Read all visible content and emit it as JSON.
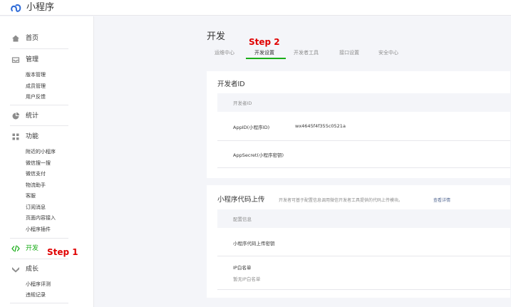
{
  "app": {
    "title": "小程序",
    "logo_icon": "mini-program-logo-icon"
  },
  "colors": {
    "accent": "#1aad19",
    "annotation": "#e00000",
    "link": "#576b95"
  },
  "sidebar": {
    "home": {
      "label": "首页",
      "icon": "home-icon"
    },
    "manage": {
      "label": "管理",
      "icon": "inbox-icon",
      "items": [
        "版本管理",
        "成员管理",
        "用户反馈"
      ]
    },
    "stats": {
      "label": "统计",
      "icon": "pie-chart-icon"
    },
    "features": {
      "label": "功能",
      "icon": "grid-icon",
      "items": [
        "附近的小程序",
        "微信搜一搜",
        "微信支付",
        "物流助手",
        "客服",
        "订阅消息",
        "页面内容接入",
        "小程序插件"
      ]
    },
    "dev": {
      "label": "开发",
      "icon": "code-icon",
      "active": true
    },
    "growth": {
      "label": "成长",
      "icon": "growth-icon",
      "items": [
        "小程序评测",
        "违规记录"
      ]
    }
  },
  "annotations": {
    "step1": "Step 1",
    "step2": "Step 2"
  },
  "page": {
    "title": "开发",
    "tabs": [
      "运维中心",
      "开发设置",
      "开发者工具",
      "接口设置",
      "安全中心"
    ],
    "active_tab": 1
  },
  "developer_id": {
    "title": "开发者ID",
    "header": "开发者ID",
    "appid_label": "AppID(小程序ID)",
    "appid_value": "wx4645f4f355c0521a",
    "appsecret_label": "AppSecret(小程序密钥)"
  },
  "code_upload": {
    "title": "小程序代码上传",
    "note": "开发者可基于配置信息调用微信开发者工具提供的代码上传模块。",
    "link": "查看详情",
    "header": "配置信息",
    "key_label": "小程序代码上传密钥",
    "ip_label": "IP白名单",
    "ip_value": "暂无IP白名单"
  }
}
